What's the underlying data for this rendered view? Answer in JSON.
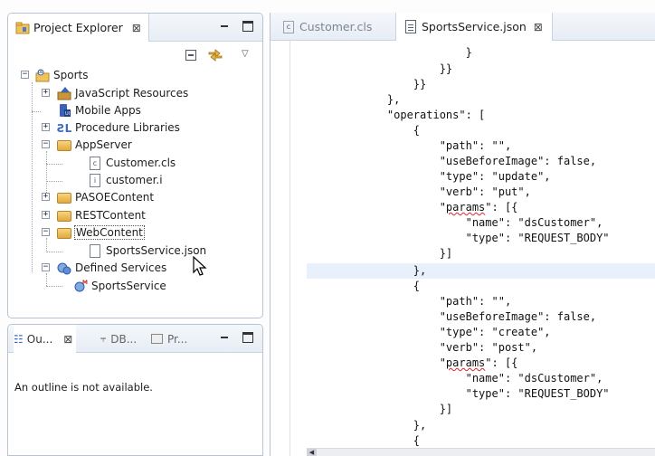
{
  "project_explorer": {
    "title": "Project Explorer",
    "tree": [
      {
        "label": "Sports",
        "expander": "−",
        "icon": "project-icon"
      },
      {
        "label": "JavaScript Resources",
        "expander": "+",
        "icon": "js-resources-icon"
      },
      {
        "label": "Mobile Apps",
        "expander": "",
        "icon": "mobile-apps-icon"
      },
      {
        "label": "Procedure Libraries",
        "expander": "+",
        "icon": "procedure-libraries-icon"
      },
      {
        "label": "AppServer",
        "expander": "−",
        "icon": "folder-icon"
      },
      {
        "label": "Customer.cls",
        "expander": "",
        "icon": "cls-file-icon"
      },
      {
        "label": "customer.i",
        "expander": "",
        "icon": "include-file-icon"
      },
      {
        "label": "PASOEContent",
        "expander": "+",
        "icon": "folder-icon"
      },
      {
        "label": "RESTContent",
        "expander": "+",
        "icon": "folder-icon"
      },
      {
        "label": "WebContent",
        "expander": "−",
        "icon": "folder-icon"
      },
      {
        "label": "SportsService.json",
        "expander": "",
        "icon": "json-file-icon"
      },
      {
        "label": "Defined Services",
        "expander": "−",
        "icon": "defined-services-icon"
      },
      {
        "label": "SportsService",
        "expander": "",
        "icon": "service-icon"
      }
    ]
  },
  "bottom_panel": {
    "tabs": [
      {
        "label": "Ou..."
      },
      {
        "label": "DB..."
      },
      {
        "label": "Pr..."
      }
    ],
    "message": "An outline is not available."
  },
  "editor": {
    "tabs": [
      {
        "label": "Customer.cls",
        "active": false
      },
      {
        "label": "SportsService.json",
        "active": true
      }
    ],
    "lines": [
      "                }",
      "            }}",
      "        }}",
      "    },",
      "    \"operations\": [",
      "        {",
      "            \"path\": \"\",",
      "            \"useBeforeImage\": false,",
      "            \"type\": \"update\",",
      "            \"verb\": \"put\",",
      "            \"params\": [{",
      "                \"name\": \"dsCustomer\",",
      "                \"type\": \"REQUEST_BODY\"",
      "            }]",
      "        },",
      "        {",
      "            \"path\": \"\",",
      "            \"useBeforeImage\": false,",
      "            \"type\": \"create\",",
      "            \"verb\": \"post\",",
      "            \"params\": [{",
      "                \"name\": \"dsCustomer\",",
      "                \"type\": \"REQUEST_BODY\"",
      "            }]",
      "        },",
      "        {"
    ]
  }
}
